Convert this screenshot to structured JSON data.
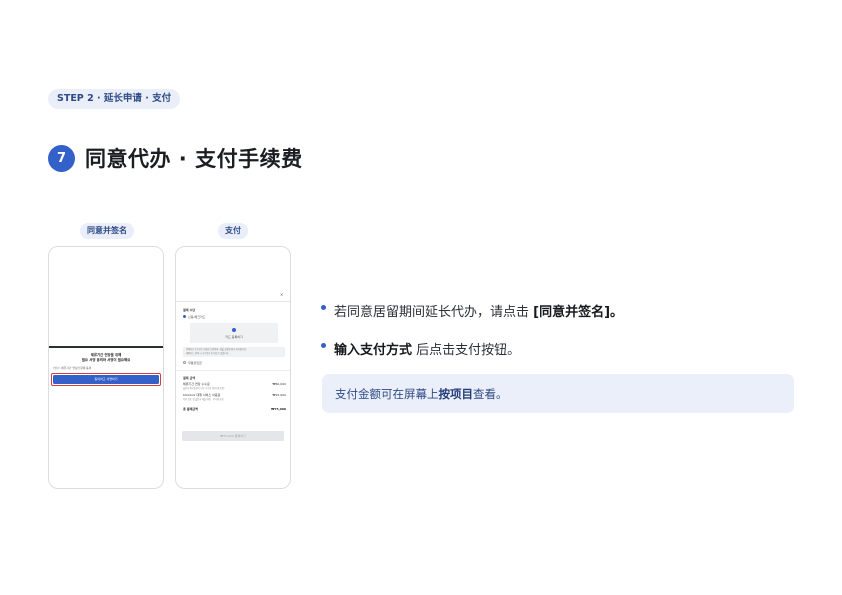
{
  "step_badge": "STEP 2 · 延长申请 · 支付",
  "section": {
    "number": "7",
    "title": "同意代办 · 支付手续费"
  },
  "phones": {
    "left": {
      "label": "同意并签名",
      "heading_line1": "체류기간 연장을 위해",
      "heading_line2": "필요 서명 동의와 서명이 필요해요",
      "checkbox_text": "(필수) 체류기간 연장신청에 동의",
      "button_label": "동의하고 서명하기"
    },
    "right": {
      "label": "支付",
      "section1_title": "결제 수단",
      "radio1": "신용/체크카드",
      "card_add": "카드 등록하기",
      "info_line1": "결제하신 수수료는 대행료 포함이며, 환불 규정에 따라 처리됩니다.",
      "info_line2": "해외카드 결제 시 수수료가 추가될 수 있습니다.",
      "radio2": "무통장입금",
      "section2_title": "결제 금액",
      "fee1_label": "체류기간 연장 수수료",
      "fee1_value": "₩60,000",
      "fee1_sub": "출입국·외국인관서 납부 수수료 (인지세 포함)",
      "fee2_label": "Klickbox 대행 서비스 이용료",
      "fee2_value": "₩15,000",
      "fee2_sub": "서류 검토 및 출입국 제출 대행 · 부가세 포함",
      "total_label": "총 결제금액",
      "total_value": "₩75,000",
      "pay_button": "₩75,000 결제하기"
    }
  },
  "bullets": [
    {
      "text_before": "若同意居留期间延长代办，请点击 ",
      "bold": "[同意并签名]",
      "text_after": "。"
    },
    {
      "bold": "输入支付方式",
      "text_after": " 后点击支付按钮。"
    }
  ],
  "note": {
    "text_before": "支付金额可在屏幕上 ",
    "bold": "按项目",
    "text_after": " 查看。"
  },
  "colors": {
    "accent": "#3460c9",
    "badge_bg": "#e9eef9",
    "badge_text": "#2f4a86",
    "highlight": "#d93a3a"
  }
}
